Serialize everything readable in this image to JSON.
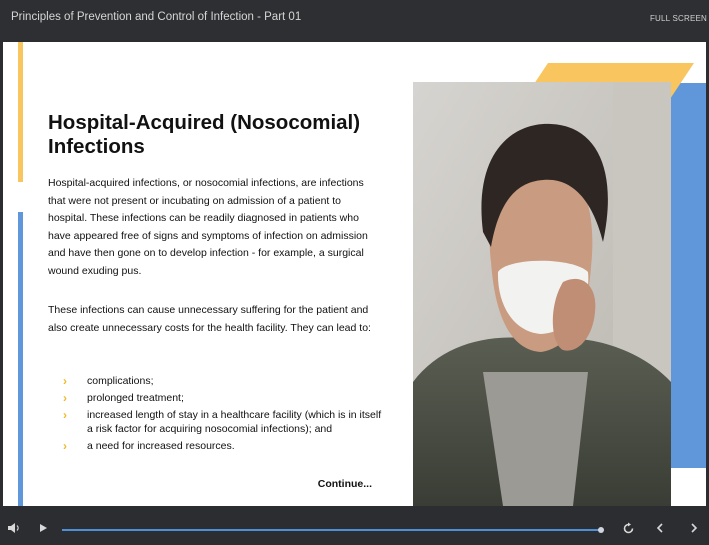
{
  "header": {
    "title": "Principles of Prevention and Control of Infection - Part 01",
    "fullscreen_label": "FULL SCREEN"
  },
  "slide": {
    "heading_line1": "Hospital-Acquired (Nosocomial)",
    "heading_line2": "Infections",
    "paragraph1": "Hospital-acquired infections, or nosocomial infections, are infections that were not present or incubating on admission of a patient to hospital. These infections can be readily diagnosed in patients who have appeared free of signs and symptoms of infection on admission and have then gone on to develop infection - for example, a surgical wound exuding pus.",
    "paragraph2": "These infections can cause unnecessary suffering for the patient and also create unnecessary costs for the health facility. They can lead to:",
    "bullets": [
      "complications;",
      "prolonged treatment;",
      "increased length of stay in a healthcare facility (which is in itself a risk factor for acquiring nosocomial infections); and",
      "a need for increased resources."
    ],
    "continue_label": "Continue...",
    "bullet_glyph": "›"
  },
  "colors": {
    "accent_yellow": "#f8c55f",
    "accent_blue": "#5f97da",
    "bullet_yellow": "#f1b82c",
    "progress_blue": "#4f8fd6"
  },
  "player": {
    "progress": 0.995,
    "icons": [
      "volume-icon",
      "play-icon",
      "replay-icon",
      "previous-icon",
      "next-icon"
    ]
  }
}
